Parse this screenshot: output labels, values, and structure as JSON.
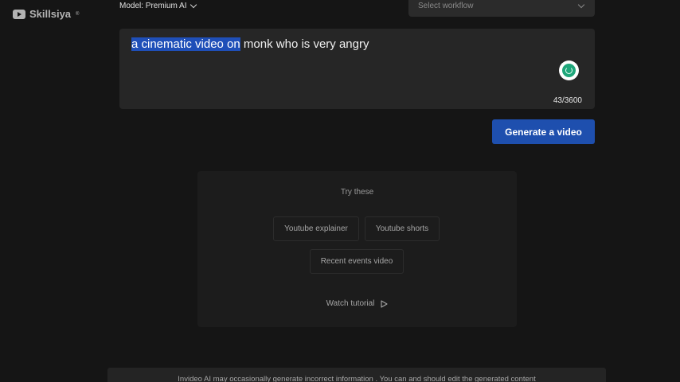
{
  "watermark": {
    "brand": "Skillsiya",
    "icon": "play-icon",
    "mark": "®"
  },
  "header": {
    "model_label": "Model: Premium AI",
    "workflow_placeholder": "Select workflow"
  },
  "prompt": {
    "selected_text": "a cinematic video on",
    "rest_text": " monk who is very angry",
    "char_count": "43/3600",
    "loading_icon": "spinner-icon"
  },
  "actions": {
    "generate_label": "Generate a video"
  },
  "suggestions": {
    "title": "Try these",
    "chips": [
      "Youtube explainer",
      "Youtube shorts",
      "Recent events video"
    ],
    "watch_tutorial": "Watch tutorial",
    "watch_icon": "play-icon"
  },
  "footer": {
    "disclaimer": "Invideo AI may occasionally generate incorrect information . You can and should edit the generated content"
  },
  "colors": {
    "background": "#151515",
    "panel": "#262626",
    "accent_button": "#1e4fae",
    "selection": "#1f4fb8",
    "spinner": "#1fa67a"
  }
}
